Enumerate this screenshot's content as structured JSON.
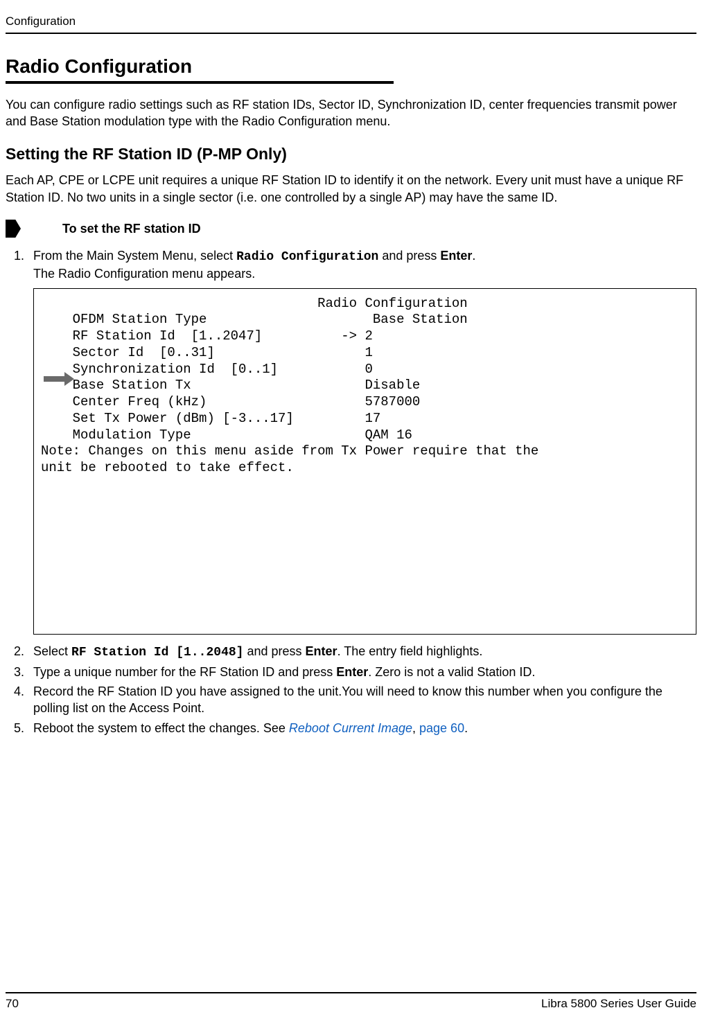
{
  "header": {
    "running_head": "Configuration"
  },
  "title": "Radio Configuration",
  "intro": "You can configure radio settings such as RF station IDs, Sector ID, Synchronization ID, center frequencies transmit power and Base Station modulation type with the Radio Configuration menu.",
  "subsection": {
    "title": "Setting the RF Station ID (P-MP Only)",
    "body": "Each AP, CPE or LCPE unit requires a unique RF Station ID to identify it on the network. Every unit must have a unique RF Station ID. No two units in a single sector (i.e. one controlled by a single AP) may have the same ID."
  },
  "procedure_label": "To set the RF station ID",
  "steps": {
    "s1_prefix": "From the Main System Menu, select ",
    "s1_cmd": "Radio Configuration",
    "s1_mid": " and press ",
    "s1_enter": "Enter",
    "s1_suffix": ".",
    "s1_line2": "The Radio Configuration menu appears.",
    "s2_prefix": "Select ",
    "s2_cmd": "RF Station Id [1..2048]",
    "s2_mid": " and press ",
    "s2_enter": "Enter",
    "s2_suffix": ". The entry field highlights.",
    "s3_prefix": "Type a unique number for the RF Station ID and press ",
    "s3_enter": "Enter",
    "s3_suffix": ". Zero is not a valid Station ID.",
    "s4": "Record the RF Station ID you have assigned to the unit.You will need to know this number when you configure the polling list on the Access Point.",
    "s5_prefix": "Reboot the system to effect the changes. See ",
    "s5_link": "Reboot Current Image",
    "s5_mid": ", ",
    "s5_pagelink": "page 60",
    "s5_suffix": "."
  },
  "terminal": {
    "title_line": "                                   Radio Configuration",
    "blank": "",
    "ofdm_line": "    OFDM Station Type                     Base Station",
    "rf_line": "    RF Station Id  [1..2047]          -> 2",
    "sector_line": "    Sector Id  [0..31]                   1",
    "sync_line": "    Synchronization Id  [0..1]           0",
    "bstx_line": "    Base Station Tx                      Disable",
    "cfreq_line": "    Center Freq (kHz)                    5787000",
    "txpwr_line": "    Set Tx Power (dBm) [-3...17]         17",
    "mod_line": "    Modulation Type                      QAM 16",
    "note_line1": "Note: Changes on this menu aside from Tx Power require that the",
    "note_line2": "unit be rebooted to take effect."
  },
  "footer": {
    "page_number": "70",
    "doc_title": "Libra 5800 Series User Guide"
  }
}
